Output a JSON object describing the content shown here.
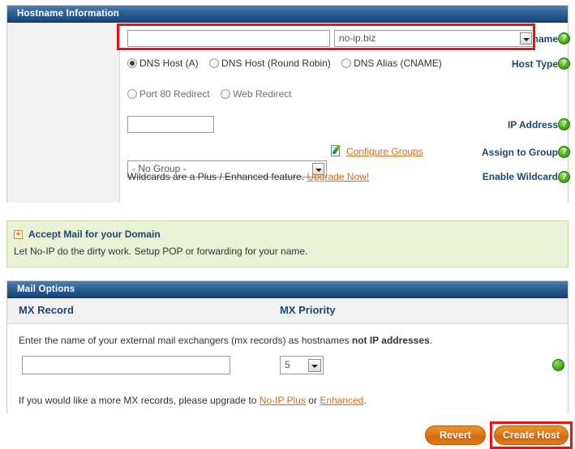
{
  "hostname_panel": {
    "title": "Hostname Information",
    "rows": {
      "hostname_label": "Hostname:",
      "hostname_value": "",
      "hostname_placeholder": "",
      "domain_selected": "no-ip.biz",
      "host_type_label": "Host Type:",
      "host_types": [
        {
          "label": "DNS Host (A)",
          "selected": true,
          "disabled": false
        },
        {
          "label": "DNS Host (Round Robin)",
          "selected": false,
          "disabled": false
        },
        {
          "label": "DNS Alias (CNAME)",
          "selected": false,
          "disabled": false
        },
        {
          "label": "Port 80 Redirect",
          "selected": false,
          "disabled": true
        },
        {
          "label": "Web Redirect",
          "selected": false,
          "disabled": true
        }
      ],
      "ip_label": "IP Address:",
      "ip_value": "",
      "group_label": "Assign to Group:",
      "group_selected": "- No Group -",
      "configure_groups_link": "Configure Groups",
      "wildcard_label": "Enable Wildcard:",
      "wildcard_text": "Wildcards are a Plus / Enhanced feature.",
      "wildcard_link": "Upgrade Now!"
    },
    "help_glyph": "?"
  },
  "accept_mail": {
    "expander_glyph": "+",
    "title": "Accept Mail for your Domain",
    "subtitle": "Let No-IP do the dirty work. Setup POP or forwarding for your name."
  },
  "mail_panel": {
    "title": "Mail Options",
    "col_mx_record": "MX Record",
    "col_mx_priority": "MX Priority",
    "description_part1": "Enter the name of your external mail exchangers (mx records) as hostnames ",
    "description_bold": "not IP addresses",
    "description_part2": ".",
    "mx_record_value": "",
    "mx_priority_selected": "5",
    "footer_part1": "If you would like a more MX records, please upgrade to ",
    "footer_link1": "No-IP Plus",
    "footer_mid": " or ",
    "footer_link2": "Enhanced",
    "footer_end": "."
  },
  "actions": {
    "revert_label": "Revert",
    "create_host_label": "Create Host"
  },
  "colors": {
    "panel_header_blue": "#2f6498",
    "label_blue": "#1f4670",
    "link_orange": "#d86a16",
    "button_orange": "#e2791b",
    "highlight_red": "#ee1111",
    "notice_green_bg": "#e9f2d4",
    "help_green": "#4cb01f"
  }
}
